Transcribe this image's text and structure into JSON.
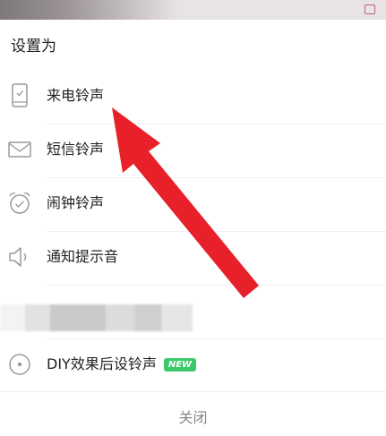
{
  "sheet": {
    "title": "设置为"
  },
  "menu": {
    "items": [
      {
        "label": "来电铃声",
        "icon": "phone-icon"
      },
      {
        "label": "短信铃声",
        "icon": "envelope-icon"
      },
      {
        "label": "闹钟铃声",
        "icon": "alarm-clock-icon"
      },
      {
        "label": "通知提示音",
        "icon": "speaker-icon"
      }
    ]
  },
  "diy": {
    "label": "DIY效果后设铃声",
    "badge": "NEW",
    "icon": "disc-icon"
  },
  "footer": {
    "close_label": "关闭"
  },
  "colors": {
    "annotation_arrow": "#e8202a",
    "new_badge": "#3cc96a",
    "icon_stroke": "#9a9a9a",
    "divider": "#eeeeee",
    "close_text": "#888888"
  }
}
